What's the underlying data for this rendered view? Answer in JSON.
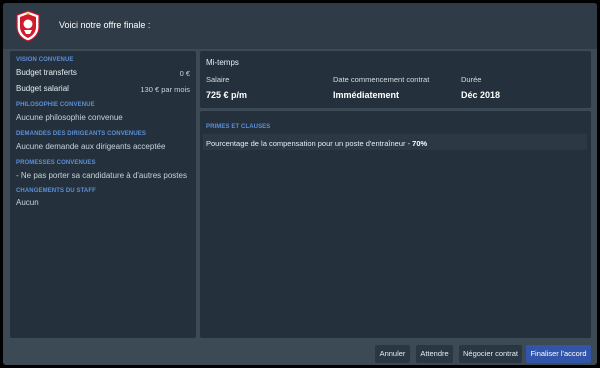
{
  "header": {
    "intro_text": "Voici notre offre finale :"
  },
  "left_panel": {
    "sections": [
      {
        "title": "Vision convenue",
        "rows": [
          {
            "label": "Budget transferts",
            "value": "0 €"
          },
          {
            "label": "Budget salarial",
            "value": "130 € par mois"
          }
        ]
      },
      {
        "title": "Philosophie convenue",
        "rows": [
          {
            "label": "Aucune philosophie convenue"
          }
        ]
      },
      {
        "title": "Demandes des dirigeants convenues",
        "rows": [
          {
            "label": "Aucune demande aux dirigeants acceptée"
          }
        ]
      },
      {
        "title": "Promesses convenues",
        "rows": [
          {
            "label": "- Ne pas porter sa candidature à d'autres postes"
          }
        ]
      },
      {
        "title": "Changements du staff",
        "rows": [
          {
            "label": "Aucun"
          }
        ]
      }
    ]
  },
  "contract": {
    "type": "Mi-temps",
    "columns": [
      {
        "label": "Salaire",
        "value": "725 € p/m"
      },
      {
        "label": "Date commencement contrat",
        "value": "Immédiatement"
      },
      {
        "label": "Durée",
        "value": "Déc 2018"
      }
    ]
  },
  "clauses": {
    "title": "Primes et clauses",
    "items": [
      {
        "text": "Pourcentage de la compensation pour un poste d'entraîneur - ",
        "value": "70%"
      }
    ]
  },
  "buttons": {
    "cancel": "Annuler",
    "wait": "Attendre",
    "negotiate": "Négocier contrat",
    "finalize": "Finaliser l'accord"
  },
  "colors": {
    "accent_section": "#5d8fd8",
    "primary_button": "#3355a9",
    "panel": "#24313c",
    "background": "#3c4a55"
  },
  "icons": {
    "club_crest": "club-crest-icon"
  }
}
